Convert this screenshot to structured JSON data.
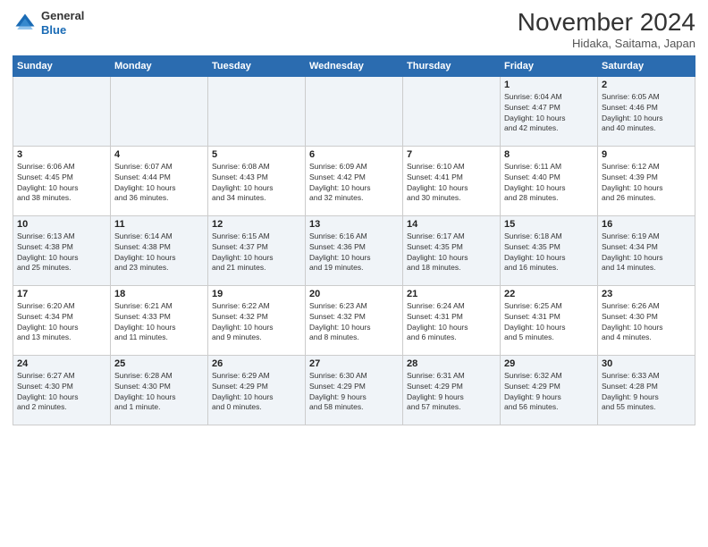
{
  "header": {
    "logo_line1": "General",
    "logo_line2": "Blue",
    "month_title": "November 2024",
    "location": "Hidaka, Saitama, Japan"
  },
  "weekdays": [
    "Sunday",
    "Monday",
    "Tuesday",
    "Wednesday",
    "Thursday",
    "Friday",
    "Saturday"
  ],
  "rows": [
    [
      {
        "day": "",
        "info": ""
      },
      {
        "day": "",
        "info": ""
      },
      {
        "day": "",
        "info": ""
      },
      {
        "day": "",
        "info": ""
      },
      {
        "day": "",
        "info": ""
      },
      {
        "day": "1",
        "info": "Sunrise: 6:04 AM\nSunset: 4:47 PM\nDaylight: 10 hours\nand 42 minutes."
      },
      {
        "day": "2",
        "info": "Sunrise: 6:05 AM\nSunset: 4:46 PM\nDaylight: 10 hours\nand 40 minutes."
      }
    ],
    [
      {
        "day": "3",
        "info": "Sunrise: 6:06 AM\nSunset: 4:45 PM\nDaylight: 10 hours\nand 38 minutes."
      },
      {
        "day": "4",
        "info": "Sunrise: 6:07 AM\nSunset: 4:44 PM\nDaylight: 10 hours\nand 36 minutes."
      },
      {
        "day": "5",
        "info": "Sunrise: 6:08 AM\nSunset: 4:43 PM\nDaylight: 10 hours\nand 34 minutes."
      },
      {
        "day": "6",
        "info": "Sunrise: 6:09 AM\nSunset: 4:42 PM\nDaylight: 10 hours\nand 32 minutes."
      },
      {
        "day": "7",
        "info": "Sunrise: 6:10 AM\nSunset: 4:41 PM\nDaylight: 10 hours\nand 30 minutes."
      },
      {
        "day": "8",
        "info": "Sunrise: 6:11 AM\nSunset: 4:40 PM\nDaylight: 10 hours\nand 28 minutes."
      },
      {
        "day": "9",
        "info": "Sunrise: 6:12 AM\nSunset: 4:39 PM\nDaylight: 10 hours\nand 26 minutes."
      }
    ],
    [
      {
        "day": "10",
        "info": "Sunrise: 6:13 AM\nSunset: 4:38 PM\nDaylight: 10 hours\nand 25 minutes."
      },
      {
        "day": "11",
        "info": "Sunrise: 6:14 AM\nSunset: 4:38 PM\nDaylight: 10 hours\nand 23 minutes."
      },
      {
        "day": "12",
        "info": "Sunrise: 6:15 AM\nSunset: 4:37 PM\nDaylight: 10 hours\nand 21 minutes."
      },
      {
        "day": "13",
        "info": "Sunrise: 6:16 AM\nSunset: 4:36 PM\nDaylight: 10 hours\nand 19 minutes."
      },
      {
        "day": "14",
        "info": "Sunrise: 6:17 AM\nSunset: 4:35 PM\nDaylight: 10 hours\nand 18 minutes."
      },
      {
        "day": "15",
        "info": "Sunrise: 6:18 AM\nSunset: 4:35 PM\nDaylight: 10 hours\nand 16 minutes."
      },
      {
        "day": "16",
        "info": "Sunrise: 6:19 AM\nSunset: 4:34 PM\nDaylight: 10 hours\nand 14 minutes."
      }
    ],
    [
      {
        "day": "17",
        "info": "Sunrise: 6:20 AM\nSunset: 4:34 PM\nDaylight: 10 hours\nand 13 minutes."
      },
      {
        "day": "18",
        "info": "Sunrise: 6:21 AM\nSunset: 4:33 PM\nDaylight: 10 hours\nand 11 minutes."
      },
      {
        "day": "19",
        "info": "Sunrise: 6:22 AM\nSunset: 4:32 PM\nDaylight: 10 hours\nand 9 minutes."
      },
      {
        "day": "20",
        "info": "Sunrise: 6:23 AM\nSunset: 4:32 PM\nDaylight: 10 hours\nand 8 minutes."
      },
      {
        "day": "21",
        "info": "Sunrise: 6:24 AM\nSunset: 4:31 PM\nDaylight: 10 hours\nand 6 minutes."
      },
      {
        "day": "22",
        "info": "Sunrise: 6:25 AM\nSunset: 4:31 PM\nDaylight: 10 hours\nand 5 minutes."
      },
      {
        "day": "23",
        "info": "Sunrise: 6:26 AM\nSunset: 4:30 PM\nDaylight: 10 hours\nand 4 minutes."
      }
    ],
    [
      {
        "day": "24",
        "info": "Sunrise: 6:27 AM\nSunset: 4:30 PM\nDaylight: 10 hours\nand 2 minutes."
      },
      {
        "day": "25",
        "info": "Sunrise: 6:28 AM\nSunset: 4:30 PM\nDaylight: 10 hours\nand 1 minute."
      },
      {
        "day": "26",
        "info": "Sunrise: 6:29 AM\nSunset: 4:29 PM\nDaylight: 10 hours\nand 0 minutes."
      },
      {
        "day": "27",
        "info": "Sunrise: 6:30 AM\nSunset: 4:29 PM\nDaylight: 9 hours\nand 58 minutes."
      },
      {
        "day": "28",
        "info": "Sunrise: 6:31 AM\nSunset: 4:29 PM\nDaylight: 9 hours\nand 57 minutes."
      },
      {
        "day": "29",
        "info": "Sunrise: 6:32 AM\nSunset: 4:29 PM\nDaylight: 9 hours\nand 56 minutes."
      },
      {
        "day": "30",
        "info": "Sunrise: 6:33 AM\nSunset: 4:28 PM\nDaylight: 9 hours\nand 55 minutes."
      }
    ]
  ]
}
